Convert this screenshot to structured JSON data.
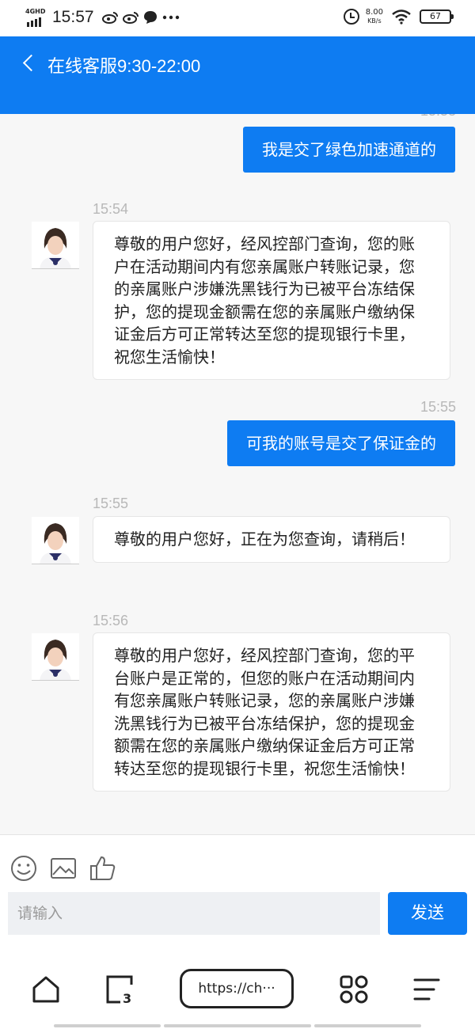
{
  "status_bar": {
    "network": "4GHD",
    "time": "15:57",
    "notification_icons": [
      "weibo-icon",
      "weibo-icon",
      "chat-bubble-icon",
      "more-icon"
    ],
    "speed_value": "8.00",
    "speed_unit": "KB/s",
    "battery": "67"
  },
  "header": {
    "title": "在线客服9:30-22:00"
  },
  "chat": {
    "messages": [
      {
        "side": "out",
        "time": "",
        "text": "我是交了绿色加速通道的"
      },
      {
        "side": "in",
        "time": "15:54",
        "text": "尊敬的用户您好，经风控部门查询，您的账户在活动期间内有您亲属账户转账记录，您的亲属账户涉嫌洗黑钱行为已被平台冻结保护，您的提现金额需在您的亲属账户缴纳保证金后方可正常转达至您的提现银行卡里，祝您生活愉快！"
      },
      {
        "side": "out",
        "time": "15:55",
        "text": "可我的账号是交了保证金的"
      },
      {
        "side": "in",
        "time": "15:55",
        "text": "尊敬的用户您好，正在为您查询，请稍后！"
      },
      {
        "side": "in",
        "time": "15:56",
        "text": "尊敬的用户您好，经风控部门查询，您的平台账户是正常的，但您的账户在活动期间内有您亲属账户转账记录，您的亲属账户涉嫌洗黑钱行为已被平台冻结保护，您的提现金额需在您的亲属账户缴纳保证金后方可正常转达至您的提现银行卡里，祝您生活愉快！"
      }
    ]
  },
  "input": {
    "tools": [
      "emoji-icon",
      "image-icon",
      "thumbs-up-icon"
    ],
    "placeholder": "请输入",
    "send_label": "发送"
  },
  "browser_bar": {
    "url": "https://ch···"
  },
  "colors": {
    "accent": "#0e7cf2",
    "background": "#f7f7f7"
  }
}
